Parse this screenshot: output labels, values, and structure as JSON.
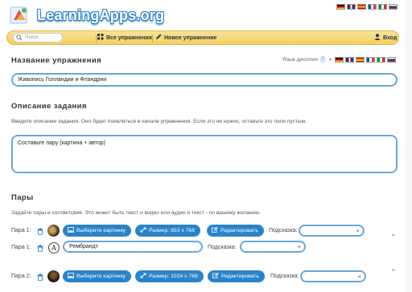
{
  "header": {
    "logo_text": "LearningApps.org",
    "flags": [
      "de",
      "en",
      "es",
      "fr",
      "it",
      "ru"
    ]
  },
  "nav": {
    "search_placeholder": "Поиск",
    "all_exercises": "Все упражнения",
    "new_exercise": "Новое упражнение",
    "login": "Вход"
  },
  "title_section": {
    "heading": "Название упражнения",
    "display_language_label": "Язык дисплея",
    "help": "?",
    "value": "Живопись Голландии и Фландрии"
  },
  "task_section": {
    "heading": "Описание задания",
    "description": "Введите описание задания. Оно будет появляться в начале упражнения. Если это не нужно, оставьте это поле пустым.",
    "value": "Составьте пару (картина + автор)"
  },
  "pairs_section": {
    "heading": "Пары",
    "description": "Задайте пары и соответсвия. Это может быть текст и видео или аудио и текст - по вашему желанию.",
    "choose_picture": "Выберите картинку",
    "edit": "Редактировать",
    "hint_label": "Подсказка:",
    "pairs": [
      {
        "label": "Пара 1:",
        "size": "Размер: 853 x 768",
        "text": "Рембрандт"
      },
      {
        "label": "Пара 2:",
        "size": "Размер: 1024 x 768"
      }
    ]
  },
  "colors": {
    "accent": "#2a83c9",
    "input_border": "#6aa6d8",
    "navbar": "#f2cf60"
  }
}
